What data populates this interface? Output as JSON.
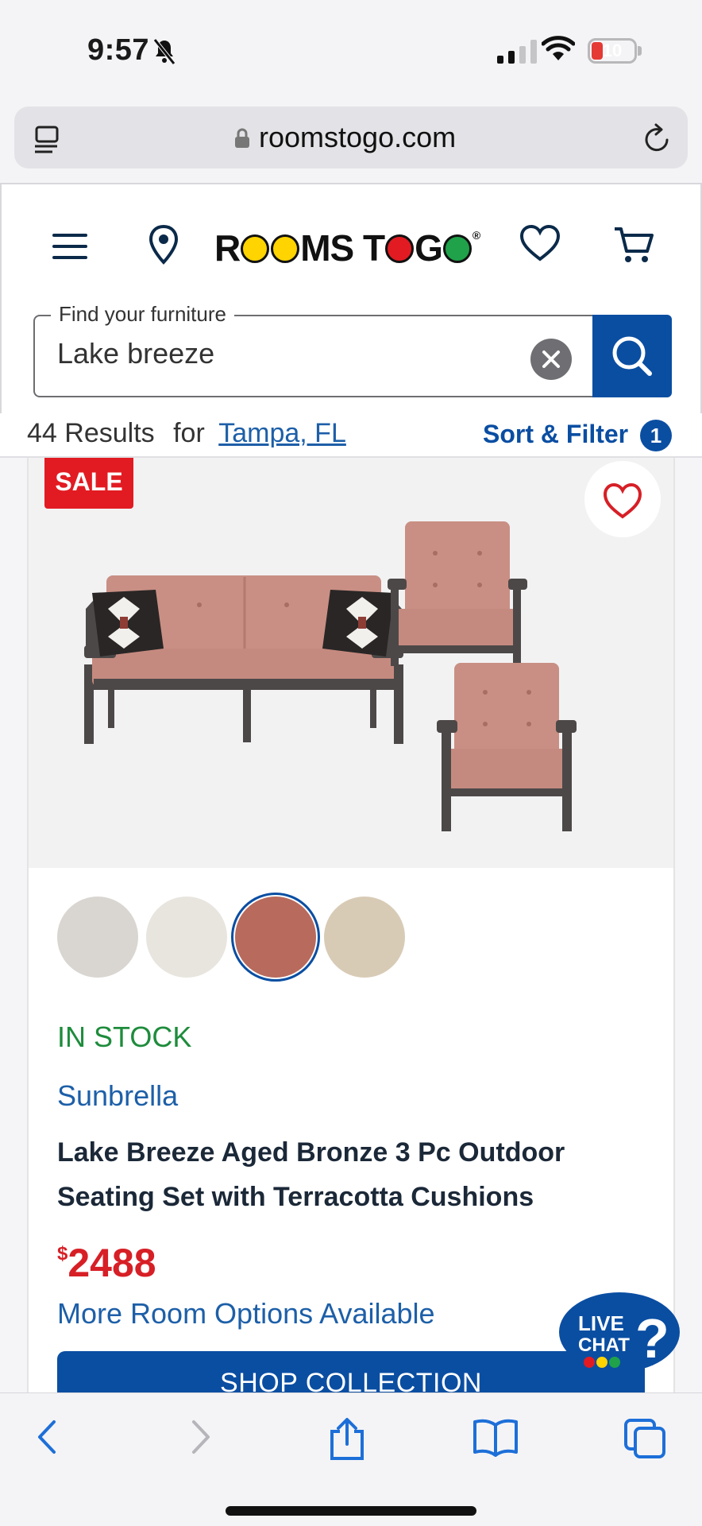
{
  "status_bar": {
    "time": "9:57",
    "battery": "10"
  },
  "browser": {
    "url": "roomstogo.com"
  },
  "header": {
    "logo_text_1": "R",
    "logo_text_2": "MS T",
    "logo_text_3": " G",
    "search_label": "Find your furniture",
    "search_value": "Lake breeze"
  },
  "results": {
    "count_text": "44 Results",
    "for_text": "for",
    "location": "Tampa, FL",
    "sort_filter_label": "Sort & Filter",
    "filter_count": "1"
  },
  "product": {
    "sale_badge": "SALE",
    "stock_status": "IN STOCK",
    "brand": "Sunbrella",
    "title": "Lake Breeze Aged Bronze 3 Pc Outdoor Seating Set with Terracotta Cushions",
    "price_currency": "$",
    "price_amount": "2488",
    "more_options": "More Room Options Available",
    "shop_button": "SHOP COLLECTION",
    "swatches": [
      {
        "color": "#d9d6d2",
        "selected": false
      },
      {
        "color": "#e8e5df",
        "selected": false
      },
      {
        "color": "#b86a5c",
        "selected": true
      },
      {
        "color": "#d8cbb6",
        "selected": false
      }
    ]
  },
  "live_chat": {
    "line1": "LIVE",
    "line2": "CHAT"
  },
  "colors": {
    "brand_blue": "#0a4ea2",
    "sale_red": "#e21b22",
    "stock_green": "#1e8c3c",
    "cushion": "#c98f84",
    "frame": "#4d4848"
  }
}
